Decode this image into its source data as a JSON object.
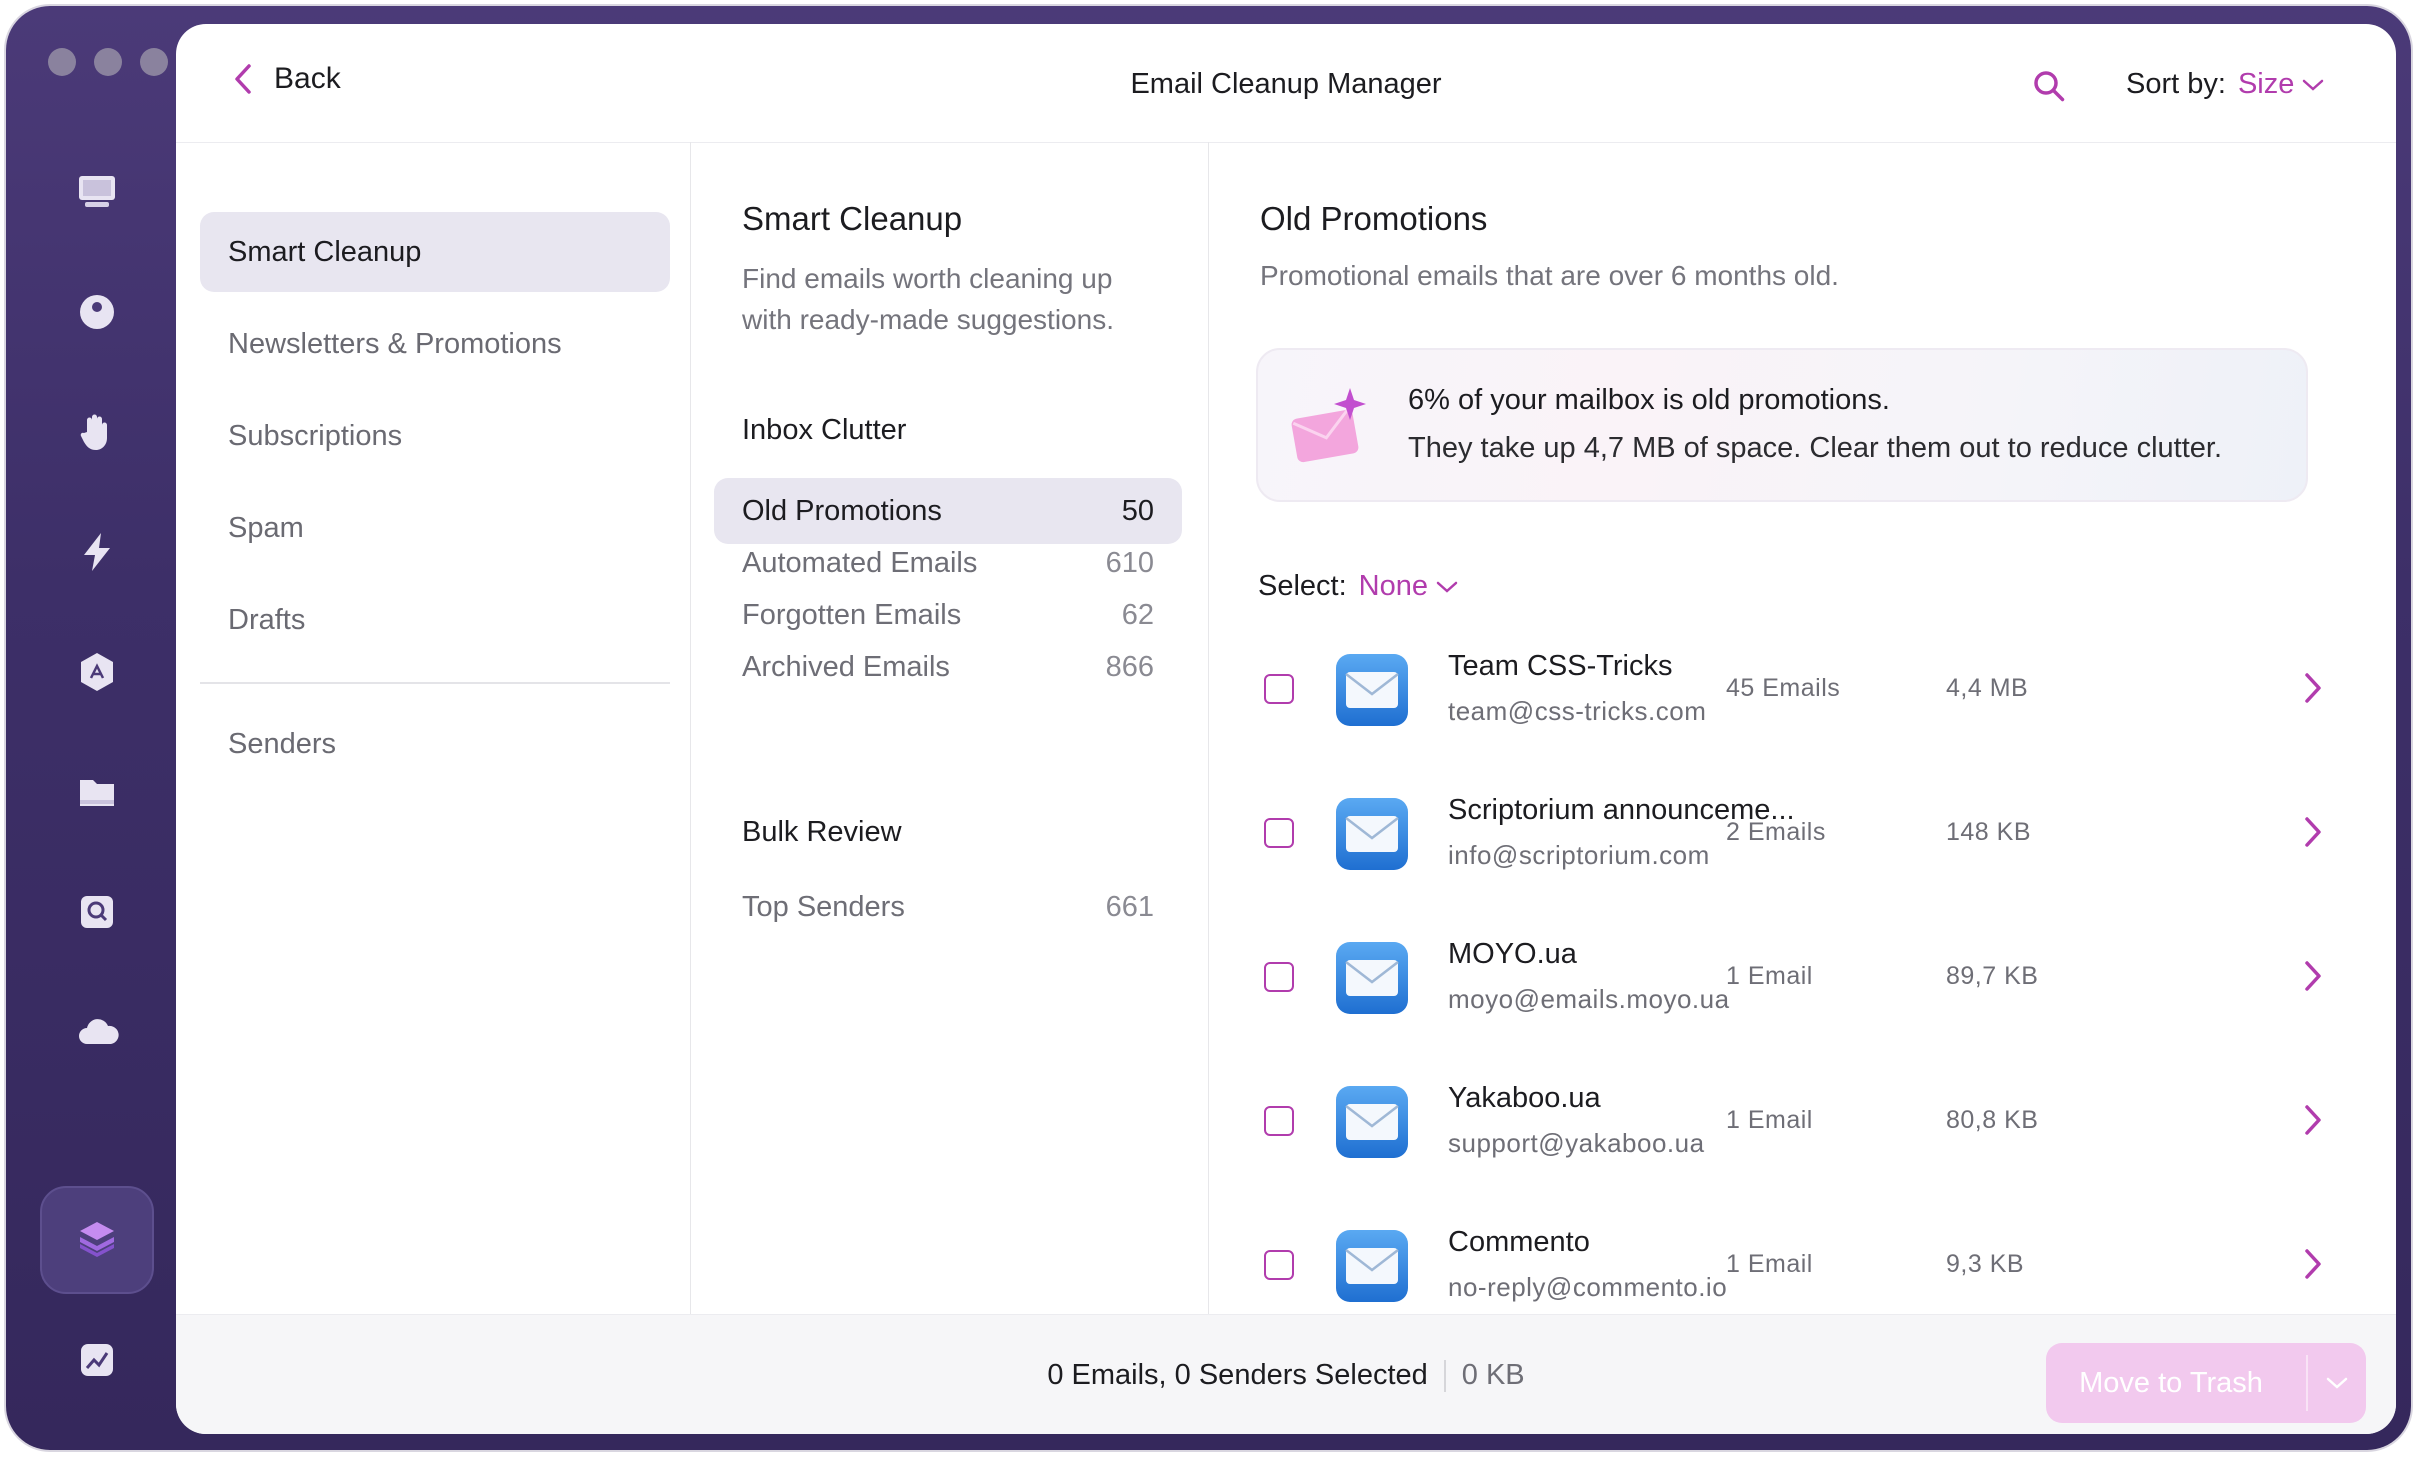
{
  "header": {
    "back_label": "Back",
    "title": "Email Cleanup Manager",
    "sort_label": "Sort by:",
    "sort_value": "Size"
  },
  "sidebar": {
    "items": [
      {
        "label": "Smart Cleanup",
        "active": true
      },
      {
        "label": "Newsletters & Promotions"
      },
      {
        "label": "Subscriptions"
      },
      {
        "label": "Spam"
      },
      {
        "label": "Drafts"
      }
    ],
    "senders_label": "Senders"
  },
  "smart": {
    "title": "Smart Cleanup",
    "description": "Find emails worth cleaning up with ready-made suggestions.",
    "inbox_clutter_label": "Inbox Clutter",
    "categories": [
      {
        "label": "Old Promotions",
        "count": "50",
        "active": true
      },
      {
        "label": "Automated Emails",
        "count": "610"
      },
      {
        "label": "Forgotten Emails",
        "count": "62"
      },
      {
        "label": "Archived Emails",
        "count": "866"
      }
    ],
    "bulk_review_label": "Bulk Review",
    "top_senders": {
      "label": "Top Senders",
      "count": "661"
    }
  },
  "detail": {
    "title": "Old Promotions",
    "description": "Promotional emails that are over 6 months old.",
    "banner_title": "6% of your mailbox is old promotions.",
    "banner_text": "They take up 4,7 MB of space. Clear them out to reduce clutter.",
    "select_label": "Select:",
    "select_value": "None",
    "senders": [
      {
        "name": "Team CSS-Tricks",
        "email": "team@css-tricks.com",
        "emails": "45 Emails",
        "size": "4,4 MB"
      },
      {
        "name": "Scriptorium announceme...",
        "email": "info@scriptorium.com",
        "emails": "2 Emails",
        "size": "148 KB"
      },
      {
        "name": "MOYO.ua",
        "email": "moyo@emails.moyo.ua",
        "emails": "1 Email",
        "size": "89,7 KB"
      },
      {
        "name": "Yakaboo.ua",
        "email": "support@yakaboo.ua",
        "emails": "1 Email",
        "size": "80,8 KB"
      },
      {
        "name": "Commento",
        "email": "no-reply@commento.io",
        "emails": "1 Email",
        "size": "9,3 KB"
      }
    ]
  },
  "footer": {
    "selection_text": "0 Emails, 0 Senders Selected",
    "size_text": "0 KB",
    "trash_label": "Move to Trash"
  },
  "colors": {
    "accent": "#b13cad",
    "sidebar_bg": "#3d2f68",
    "trash_disabled": "#f2c9ee"
  },
  "rail_icons": [
    "monitor-icon",
    "disc-icon",
    "hand-icon",
    "lightning-icon",
    "apps-icon",
    "folder-icon",
    "search-disk-icon",
    "cloud-icon",
    "layers-icon",
    "chart-icon"
  ]
}
